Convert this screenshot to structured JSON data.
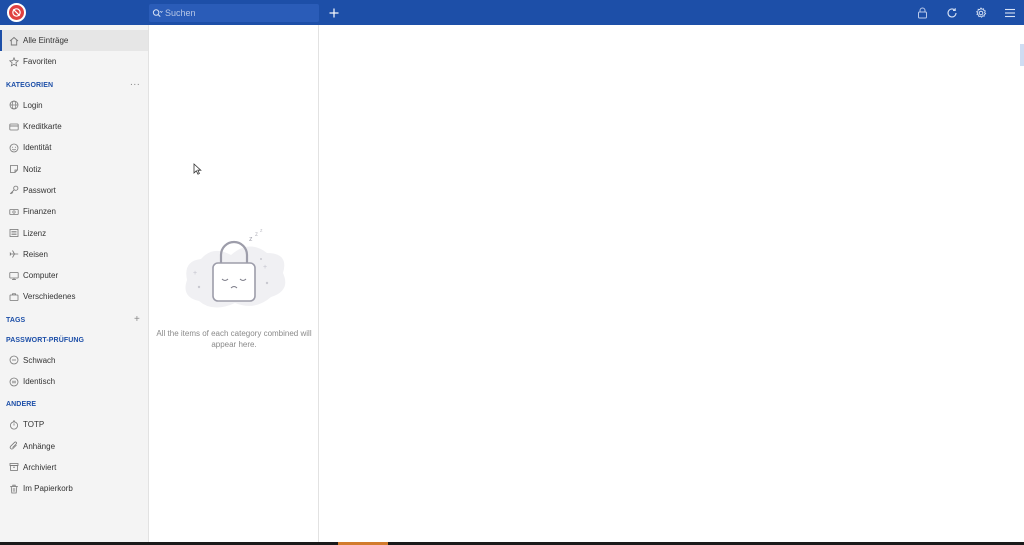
{
  "search": {
    "placeholder": "Suchen"
  },
  "sidebar": {
    "top_items": [
      {
        "label": "Alle Einträge",
        "icon": "home-icon",
        "active": true
      },
      {
        "label": "Favoriten",
        "icon": "star-icon"
      }
    ],
    "kategorien": {
      "heading": "KATEGORIEN",
      "action": "···",
      "items": [
        {
          "label": "Login",
          "icon": "globe-icon"
        },
        {
          "label": "Kreditkarte",
          "icon": "credit-card-icon"
        },
        {
          "label": "Identität",
          "icon": "face-icon"
        },
        {
          "label": "Notiz",
          "icon": "note-icon"
        },
        {
          "label": "Passwort",
          "icon": "key-icon"
        },
        {
          "label": "Finanzen",
          "icon": "money-icon"
        },
        {
          "label": "Lizenz",
          "icon": "license-icon"
        },
        {
          "label": "Reisen",
          "icon": "plane-icon"
        },
        {
          "label": "Computer",
          "icon": "monitor-icon"
        },
        {
          "label": "Verschiedenes",
          "icon": "briefcase-icon"
        }
      ]
    },
    "tags": {
      "heading": "TAGS",
      "action": "+"
    },
    "passwort_pruefung": {
      "heading": "PASSWORT-PRÜFUNG",
      "items": [
        {
          "label": "Schwach",
          "icon": "weak-icon"
        },
        {
          "label": "Identisch",
          "icon": "identical-icon"
        }
      ]
    },
    "andere": {
      "heading": "ANDERE",
      "items": [
        {
          "label": "TOTP",
          "icon": "timer-icon"
        },
        {
          "label": "Anhänge",
          "icon": "paperclip-icon"
        },
        {
          "label": "Archiviert",
          "icon": "archive-icon"
        },
        {
          "label": "Im Papierkorb",
          "icon": "trash-icon"
        }
      ]
    }
  },
  "list": {
    "empty_message": "All the items of each category combined will appear here."
  },
  "colors": {
    "accent": "#1d4fa8",
    "logo": "#e04040"
  }
}
